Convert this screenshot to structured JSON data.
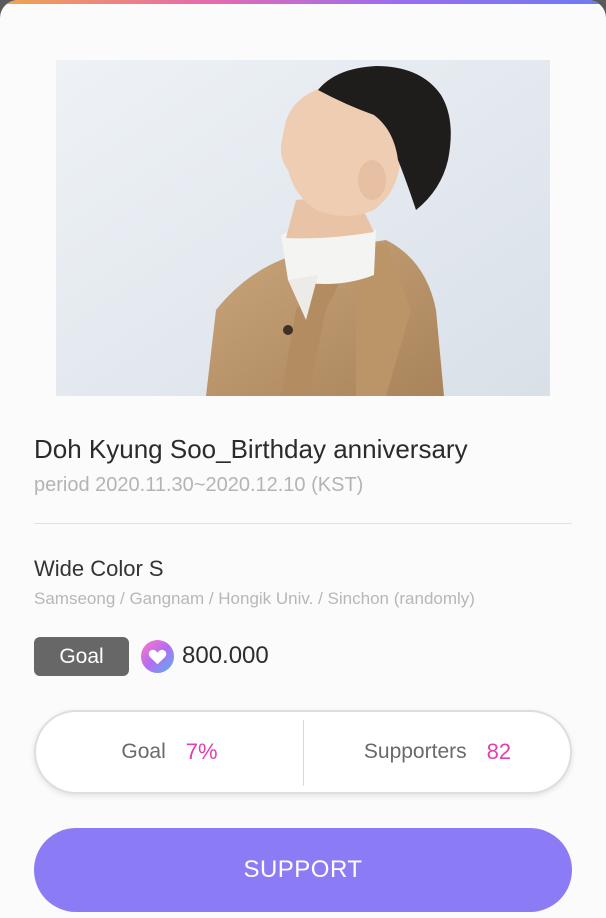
{
  "campaign": {
    "title": "Doh Kyung Soo_Birthday anniversary",
    "period": "period 2020.11.30~2020.12.10 (KST)"
  },
  "product": {
    "name": "Wide Color S",
    "locations": "Samseong / Gangnam / Hongik Univ. / Sinchon (randomly)"
  },
  "goal": {
    "badge_label": "Goal",
    "amount": "800.000",
    "icon": "heart-icon"
  },
  "stats": {
    "goal_label": "Goal",
    "goal_value": "7%",
    "supporters_label": "Supporters",
    "supporters_value": "82"
  },
  "support_button": {
    "label": "SUPPORT"
  },
  "colors": {
    "accent_pink": "#e23fb0",
    "button_purple": "#8b7cf6",
    "badge_gray": "#676767"
  }
}
